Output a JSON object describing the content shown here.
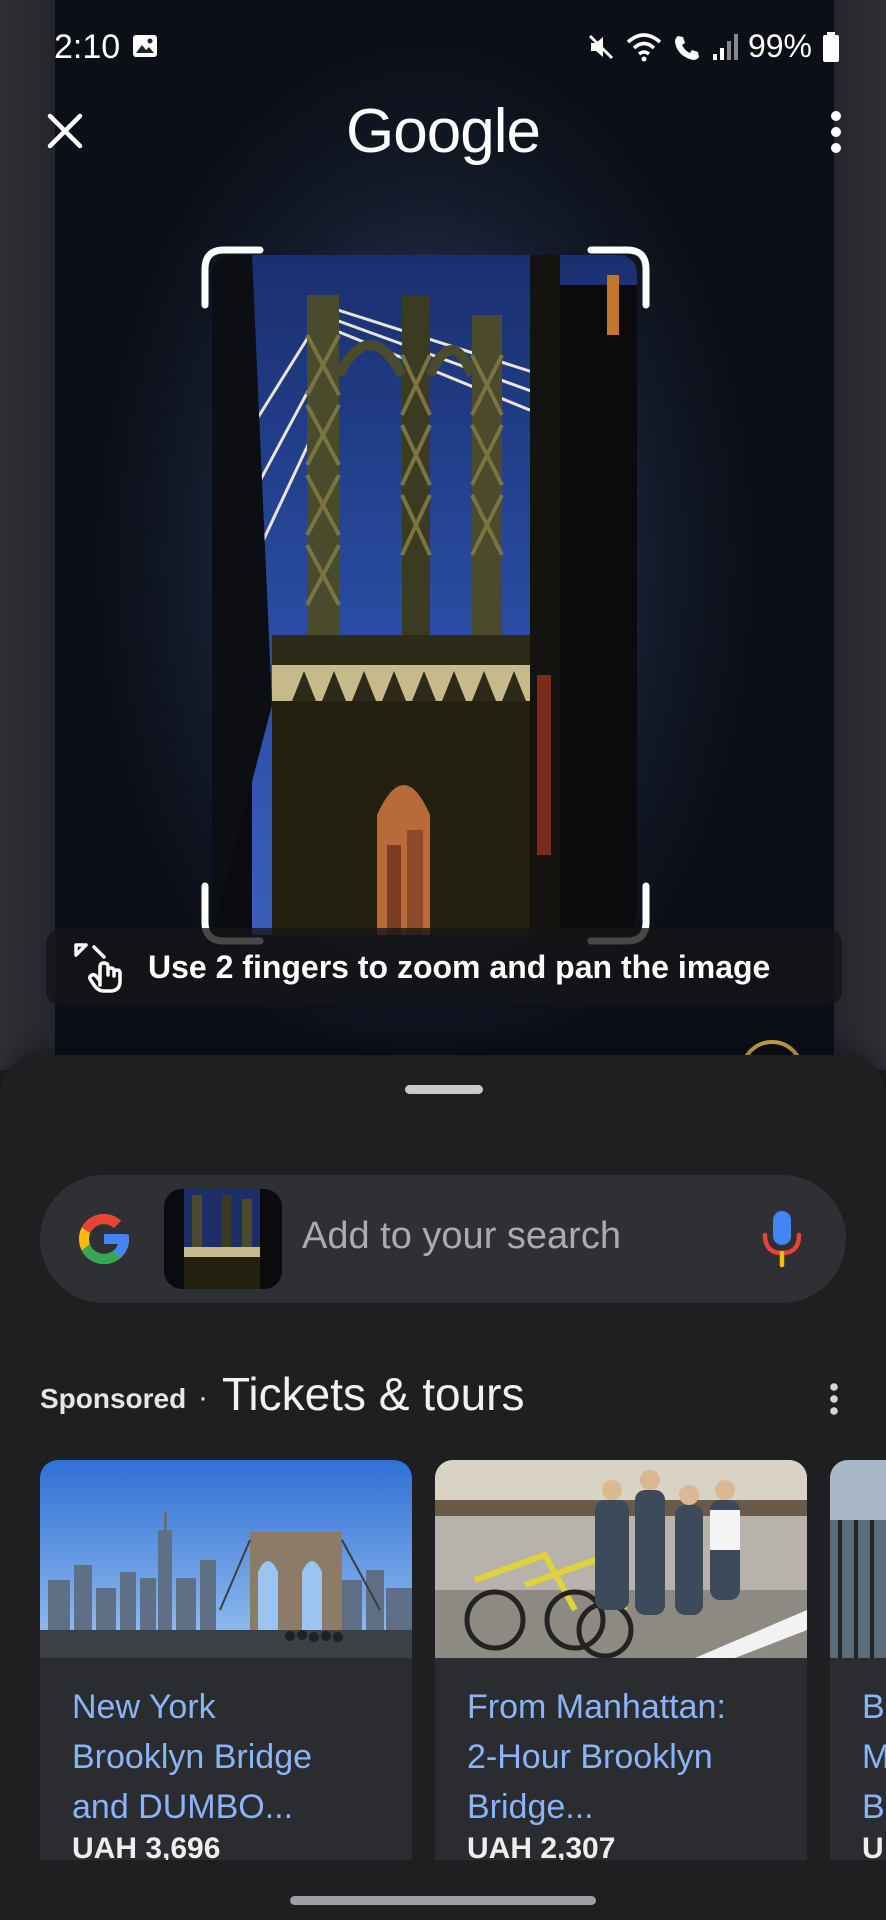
{
  "status_bar": {
    "time": "2:10",
    "battery": "99%"
  },
  "top_bar": {
    "title": "Google"
  },
  "hint": {
    "text": "Use 2 fingers to zoom and pan the image"
  },
  "search": {
    "placeholder": "Add to your search"
  },
  "section": {
    "sponsored_label": "Sponsored",
    "separator": "·",
    "title": "Tickets & tours"
  },
  "cards": [
    {
      "title_lines": [
        "New York",
        "Brooklyn Bridge",
        "and DUMBO..."
      ],
      "price": "UAH 3,696"
    },
    {
      "title_lines": [
        "From Manhattan:",
        "2-Hour Brooklyn",
        "Bridge..."
      ],
      "price": "UAH 2,307"
    },
    {
      "title_lines": [
        "Br",
        "M",
        "Br"
      ],
      "price": "U"
    }
  ],
  "icons": {
    "close": "close-icon",
    "menu": "more-vert-icon",
    "zoom_hint": "pinch-zoom-icon",
    "google": "google-g-icon",
    "mic": "mic-icon"
  },
  "colors": {
    "link": "#8ab4f8",
    "sheet_bg": "#1f1f21",
    "search_bg": "#2f3033",
    "google_blue": "#4285f4",
    "google_red": "#ea4335",
    "google_yellow": "#fbbc05",
    "google_green": "#34a853"
  }
}
